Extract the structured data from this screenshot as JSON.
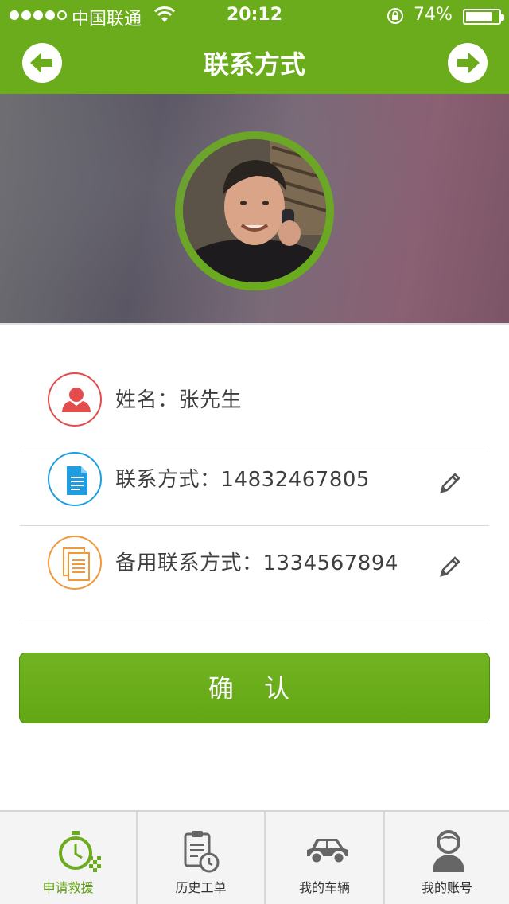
{
  "status_bar": {
    "carrier": "中国联通",
    "time": "20:12",
    "battery": "74%",
    "battery_level": 0.74
  },
  "nav": {
    "title": "联系方式",
    "back_icon": "arrow-left-icon",
    "forward_icon": "arrow-right-icon"
  },
  "form": {
    "name_label": "姓名：张先生",
    "phone_label": "联系方式：14832467805",
    "backup_phone_label": "备用联系方式：1334567894",
    "name_icon_color": "#e44b4b",
    "phone_icon_color": "#1e9ee0",
    "backup_icon_color": "#f0983a"
  },
  "confirm_button": "确 认",
  "tabs": [
    {
      "label": "申请救援",
      "icon": "stopwatch-flag-icon",
      "active": true
    },
    {
      "label": "历史工单",
      "icon": "clipboard-clock-icon",
      "active": false
    },
    {
      "label": "我的车辆",
      "icon": "car-icon",
      "active": false
    },
    {
      "label": "我的账号",
      "icon": "user-account-icon",
      "active": false
    }
  ],
  "colors": {
    "brand_green": "#6aac1b",
    "active_tab": "#5e9f13"
  }
}
